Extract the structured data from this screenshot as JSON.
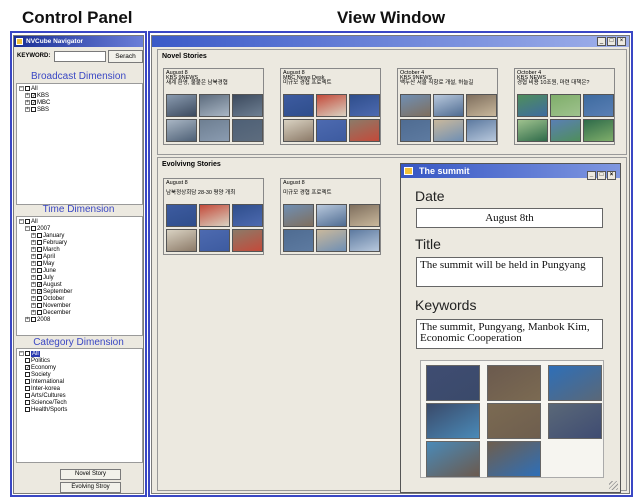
{
  "headings": {
    "control_panel": "Control Panel",
    "view_window": "View Window"
  },
  "control_panel": {
    "title": "NVCube Navigator",
    "keyword_label": "KEYWORD:",
    "keyword_value": "",
    "search_label": "Serach",
    "broadcast_title": "Broadcast Dimension",
    "broadcast": [
      {
        "label": "All",
        "checked": false,
        "level": 0,
        "expander": "−"
      },
      {
        "label": "KBS",
        "checked": true,
        "level": 1,
        "expander": "+"
      },
      {
        "label": "MBC",
        "checked": true,
        "level": 1,
        "expander": "+"
      },
      {
        "label": "SBS",
        "checked": false,
        "level": 1,
        "expander": "+"
      }
    ],
    "time_title": "Time Dimension",
    "time": [
      {
        "label": "All",
        "checked": false,
        "level": 0,
        "expander": "−"
      },
      {
        "label": "2007",
        "checked": false,
        "level": 1,
        "expander": "−"
      },
      {
        "label": "January",
        "checked": false,
        "level": 2,
        "expander": "+"
      },
      {
        "label": "February",
        "checked": false,
        "level": 2,
        "expander": "+"
      },
      {
        "label": "March",
        "checked": false,
        "level": 2,
        "expander": "+"
      },
      {
        "label": "April",
        "checked": false,
        "level": 2,
        "expander": "+"
      },
      {
        "label": "May",
        "checked": false,
        "level": 2,
        "expander": "+"
      },
      {
        "label": "June",
        "checked": false,
        "level": 2,
        "expander": "+"
      },
      {
        "label": "July",
        "checked": false,
        "level": 2,
        "expander": "+"
      },
      {
        "label": "August",
        "checked": true,
        "level": 2,
        "expander": "+"
      },
      {
        "label": "September",
        "checked": true,
        "level": 2,
        "expander": "+"
      },
      {
        "label": "October",
        "checked": false,
        "level": 2,
        "expander": "+"
      },
      {
        "label": "November",
        "checked": false,
        "level": 2,
        "expander": "+"
      },
      {
        "label": "December",
        "checked": false,
        "level": 2,
        "expander": "+"
      },
      {
        "label": "2008",
        "checked": false,
        "level": 1,
        "expander": "+"
      }
    ],
    "category_title": "Category Dimension",
    "category": [
      {
        "label": "All",
        "checked": false,
        "level": 0,
        "expander": "−",
        "selected": true
      },
      {
        "label": "Politics",
        "checked": false,
        "level": 1
      },
      {
        "label": "Economy",
        "checked": true,
        "level": 1
      },
      {
        "label": "Society",
        "checked": false,
        "level": 1
      },
      {
        "label": "International",
        "checked": false,
        "level": 1
      },
      {
        "label": "Inter-korea",
        "checked": false,
        "level": 1
      },
      {
        "label": "Arts/Cultures",
        "checked": false,
        "level": 1
      },
      {
        "label": "Science/Tech",
        "checked": false,
        "level": 1
      },
      {
        "label": "Health/Sports",
        "checked": false,
        "level": 1
      }
    ],
    "novel_story_button": "Novel Story",
    "evolving_story_button": "Evolving Stroy"
  },
  "view_window": {
    "window_buttons": [
      "_",
      "□",
      "×"
    ],
    "novel_title": "Novel Stories",
    "novel_cards": [
      {
        "date": "August 8",
        "source": "KBS 9NEWS",
        "headline": "새계 환영, 불붙은 남북경협"
      },
      {
        "date": "August 8",
        "source": "MBC News Desk",
        "headline": "미규모 경협 프로젝트"
      },
      {
        "date": "October 4",
        "source": "KBS 9NEWS",
        "headline": "백두산 서울 직항로 개설, 허늘길"
      },
      {
        "date": "October 4",
        "source": "KBS NEWS",
        "headline": "경협 비용 10조원, 마련 대책은?"
      }
    ],
    "evolving_title": "Evolvivng Stories",
    "evolving_cards": [
      {
        "date": "August 8",
        "source": "",
        "headline": "남북정상회담 28-30 평양 개최"
      },
      {
        "date": "August 8",
        "source": "",
        "headline": "미규모 경협 프로젝트"
      }
    ]
  },
  "summit": {
    "title": "The summit",
    "window_buttons": [
      "_",
      "□",
      "×"
    ],
    "date_label": "Date",
    "date_value": "August 8th",
    "title_label": "Title",
    "title_value": "The summit will be held in Pungyang",
    "keywords_label": "Keywords",
    "keywords_value": "The summit, Pungyang, Manbok Kim, Economic Cooperation"
  },
  "colors": {
    "frame_blue": "#3a47c4",
    "titlebar_blue": "#1a2f96",
    "window_bg": "#ece9e0",
    "dimension_title": "#3a47c4"
  }
}
